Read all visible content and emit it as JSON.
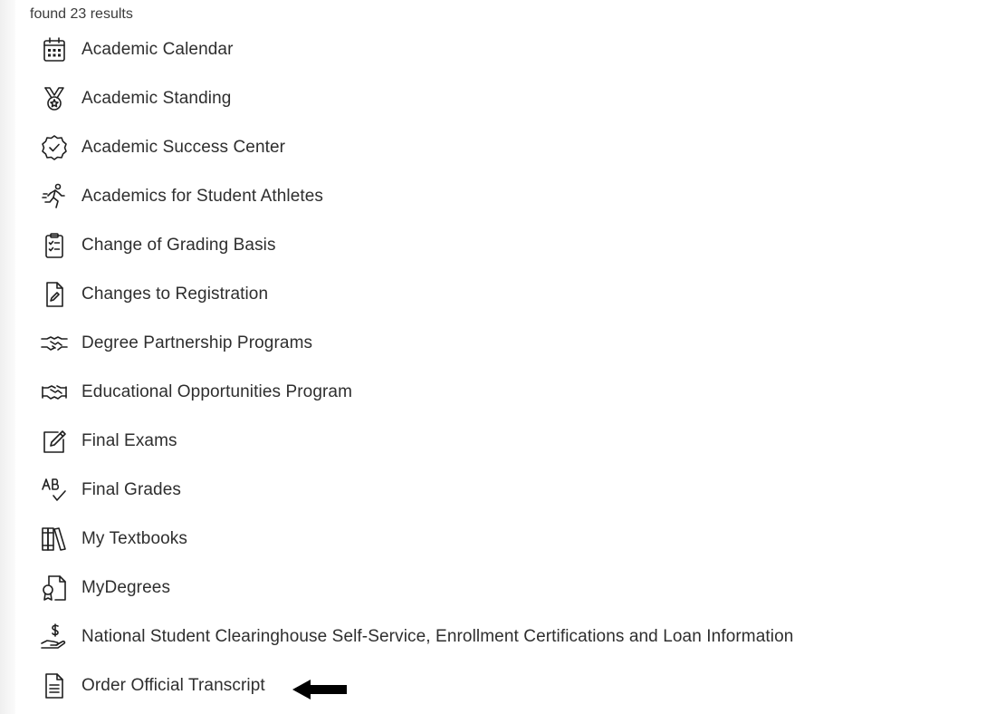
{
  "results": {
    "count_text": "found 23 results",
    "items": [
      {
        "label": "Academic Calendar",
        "icon": "calendar-icon"
      },
      {
        "label": "Academic Standing",
        "icon": "medal-icon"
      },
      {
        "label": "Academic Success Center",
        "icon": "badge-check-icon"
      },
      {
        "label": "Academics for Student Athletes",
        "icon": "runner-icon"
      },
      {
        "label": "Change of Grading Basis",
        "icon": "clipboard-checklist-icon"
      },
      {
        "label": "Changes to Registration",
        "icon": "document-edit-icon"
      },
      {
        "label": "Degree Partnership Programs",
        "icon": "handshake-icon"
      },
      {
        "label": "Educational Opportunities Program",
        "icon": "handshake-bold-icon"
      },
      {
        "label": "Final Exams",
        "icon": "pencil-square-icon"
      },
      {
        "label": "Final Grades",
        "icon": "ab-check-icon"
      },
      {
        "label": "My Textbooks",
        "icon": "books-icon"
      },
      {
        "label": "MyDegrees",
        "icon": "diploma-icon"
      },
      {
        "label": "National Student Clearinghouse Self-Service, Enrollment Certifications and Loan Information",
        "icon": "hand-dollar-icon"
      },
      {
        "label": "Order Official Transcript",
        "icon": "document-lines-icon"
      }
    ]
  },
  "annotation": {
    "arrow_icon": "left-arrow-icon",
    "arrow_color": "#000000"
  }
}
